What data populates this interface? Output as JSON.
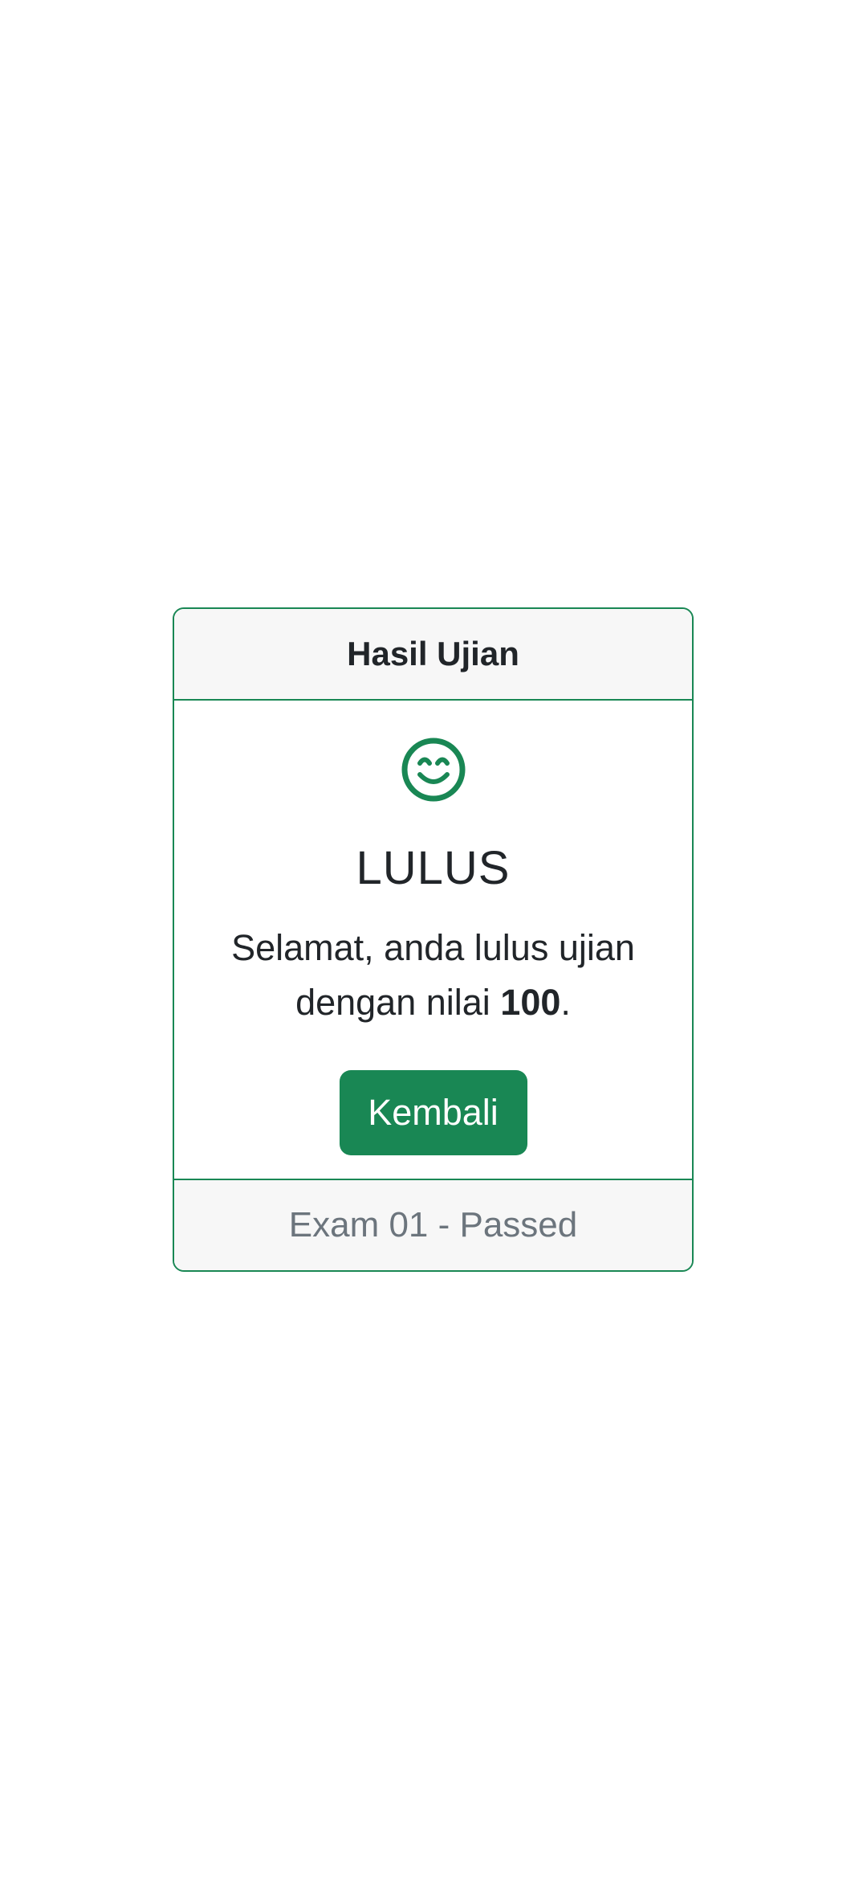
{
  "card": {
    "header_title": "Hasil Ujian",
    "icon": "smile-icon",
    "status": "LULUS",
    "message_prefix": "Selamat, anda lulus ujian dengan nilai ",
    "score": "100",
    "message_suffix": ".",
    "button_label": "Kembali",
    "footer_text": "Exam 01 - Passed"
  },
  "colors": {
    "accent": "#198754",
    "header_bg": "#f7f7f7",
    "footer_text": "#6c757d",
    "text": "#212529"
  }
}
